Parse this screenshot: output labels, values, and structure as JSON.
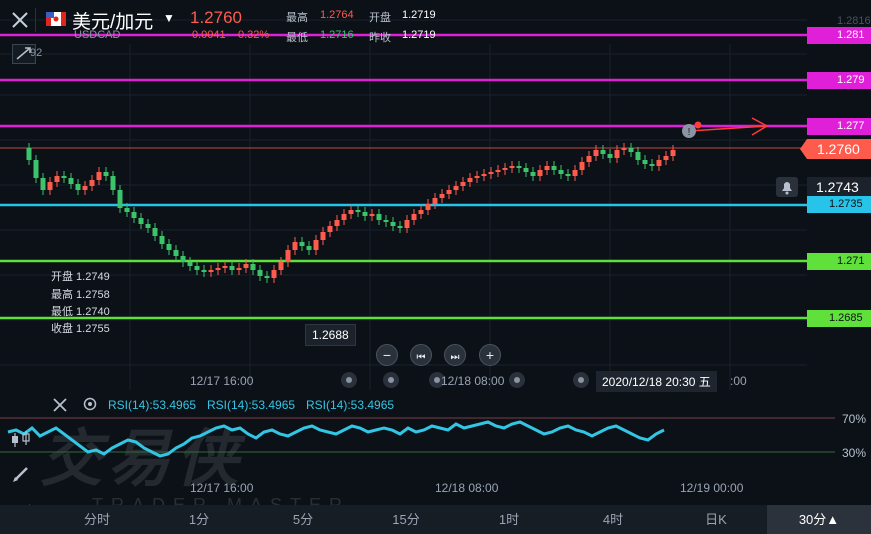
{
  "header": {
    "symbol": "美元/加元",
    "code": "USDCAD",
    "price": "1.2760",
    "change": "0.0041",
    "change_pct": "0.32%",
    "high_label": "最高",
    "high": "1.2764",
    "open_label": "开盘",
    "open": "1.2719",
    "low_label": "最低",
    "low": "1.2716",
    "prev_label": "昨收",
    "prev": "1.2719",
    "level_count": "92",
    "up_color": "#ff5b4d",
    "down_color": "#3cc46a"
  },
  "ohlc_panel": {
    "open": "开盘 1.2749",
    "high": "最高 1.2758",
    "low": "最低 1.2740",
    "close": "收盘 1.2755"
  },
  "price_labels": {
    "top": "1.2816",
    "l1": "1.281",
    "l2": "1.279",
    "l3": "1.277",
    "current": "1.2760",
    "alert": "1.2743",
    "l4": "1.2735",
    "l5": "1.271",
    "l6": "1.2685"
  },
  "tooltips": {
    "low_value": "1.2688",
    "crosshair_time": "2020/12/18  20:30 五"
  },
  "time_axis": {
    "main": [
      "12/17 16:00",
      "12/18 08:00",
      ":00"
    ],
    "rsi": [
      "12/17 16:00",
      "12/18 08:00",
      "12/19 00:00"
    ]
  },
  "rsi": {
    "label1": "RSI(14):53.4965",
    "label2": "RSI(14):53.4965",
    "label3": "RSI(14):53.4965",
    "level_high": "70%",
    "level_low": "30%",
    "line_color": "#33c6e4"
  },
  "watermark": {
    "cn": "交易侠",
    "en": "TRADER MASTER"
  },
  "tabs": [
    "分时",
    "1分",
    "5分",
    "15分",
    "1时",
    "4时",
    "日K",
    "30分▲"
  ],
  "line_colors": {
    "magenta": "#e020d8",
    "cyan": "#27c3e8",
    "green": "#5fe03a",
    "current": "#ff5b4d"
  }
}
